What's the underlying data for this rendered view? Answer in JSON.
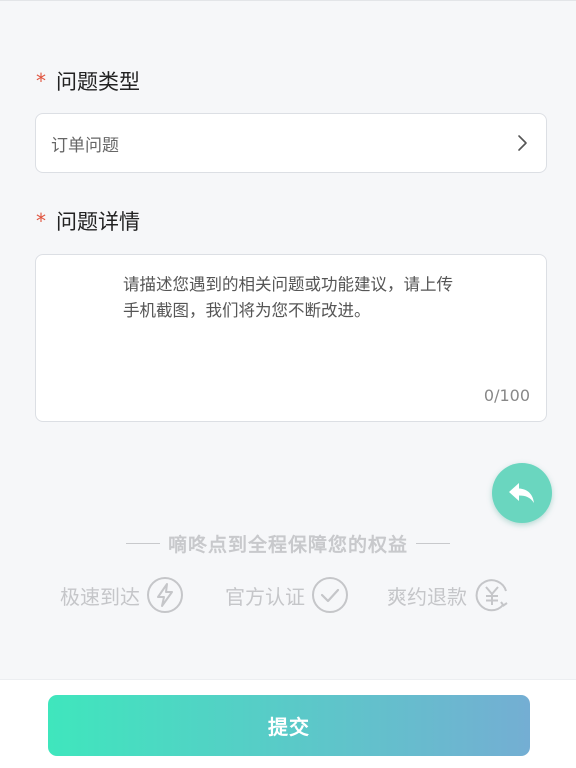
{
  "form": {
    "problem_type": {
      "required_mark": "*",
      "label": "问题类型",
      "value": "订单问题"
    },
    "problem_detail": {
      "required_mark": "*",
      "label": "问题详情",
      "placeholder": "请描述您遇到的相关问题或功能建议，请上传手机截图，我们将为您不断改进。",
      "counter": "0/100"
    }
  },
  "guarantee": {
    "title": "嘀咚点到全程保障您的权益",
    "features": [
      {
        "label": "极速到达",
        "icon": "lightning-icon"
      },
      {
        "label": "官方认证",
        "icon": "checkmark-circle-icon"
      },
      {
        "label": "爽约退款",
        "icon": "yen-refund-icon"
      }
    ]
  },
  "actions": {
    "back_icon": "reply-arrow-icon",
    "submit_label": "提交"
  },
  "colors": {
    "accent_start": "#3fe6bd",
    "accent_end": "#74aed3",
    "fab": "#6ad6bf",
    "required": "#e0533e"
  }
}
